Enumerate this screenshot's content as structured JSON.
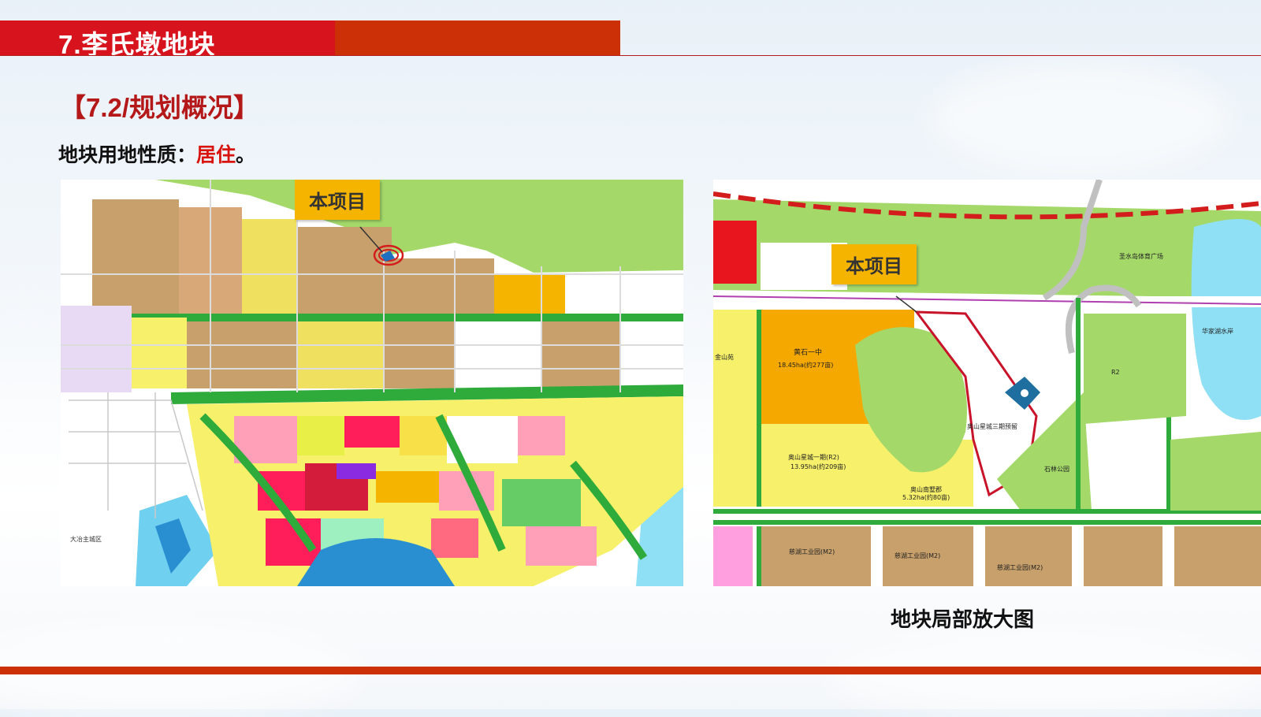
{
  "header": {
    "title": "7.李氏墩地块",
    "colors": {
      "red": "#d7141e",
      "orange_red": "#cc3006"
    }
  },
  "section": {
    "heading": "【7.2/规划概况】"
  },
  "land_use": {
    "label": "地块用地性质：",
    "value": "居住",
    "end": "。"
  },
  "map_overview": {
    "callout": "本项目",
    "district_label": "大冶主城区"
  },
  "map_zoom": {
    "callout": "本项目",
    "labels": {
      "school": "黄石一中",
      "school_area": "18.45ha(约277亩)",
      "phase1": "奥山星城一期(R2)",
      "phase1_area": "13.95ha(约209亩)",
      "villa": "奥山南墅郡",
      "villa_area": "5.32ha(约80亩)",
      "phase3": "奥山星城三期预留",
      "park": "石林公园",
      "industrial1": "慈湖工业园(M2)",
      "industrial2": "慈湖工业园(M2)",
      "industrial3": "慈湖工业园(M2)",
      "jinshan": "金山苑",
      "north_label": "圣水岛体育广场",
      "lake_label": "华家湖水岸",
      "r2": "R2"
    },
    "caption": "地块局部放大图"
  }
}
